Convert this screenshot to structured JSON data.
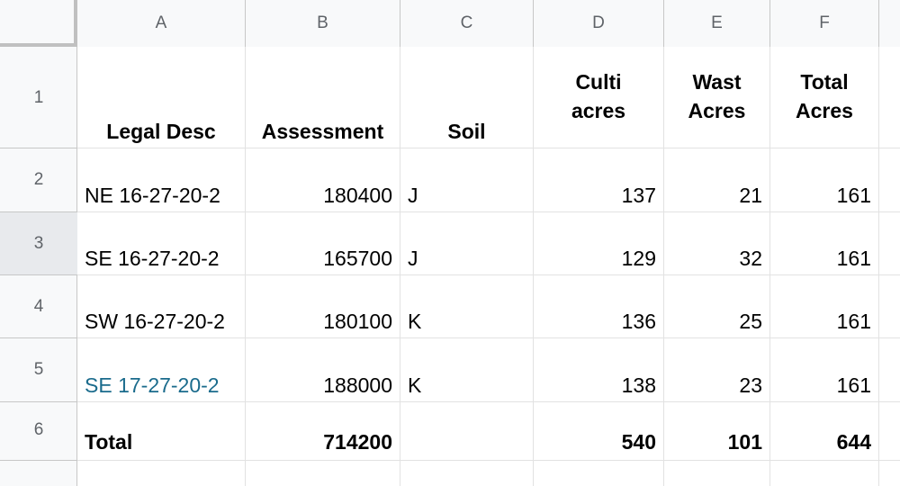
{
  "columns": [
    "A",
    "B",
    "C",
    "D",
    "E",
    "F"
  ],
  "rows": [
    "1",
    "2",
    "3",
    "4",
    "5",
    "6"
  ],
  "header": {
    "legal_desc": "Legal Desc",
    "assessment": "Assessment",
    "soil": "Soil",
    "culti_line1": "Culti",
    "culti_line2": "acres",
    "wast_line1": "Wast",
    "wast_line2": "Acres",
    "total_line1": "Total",
    "total_line2": "Acres"
  },
  "data_rows": [
    {
      "legal": "NE 16-27-20-2",
      "assessment": "180400",
      "soil": "J",
      "culti": "137",
      "wast": "21",
      "total": "161"
    },
    {
      "legal": "SE 16-27-20-2",
      "assessment": "165700",
      "soil": "J",
      "culti": "129",
      "wast": "32",
      "total": "161"
    },
    {
      "legal": "SW 16-27-20-2",
      "assessment": "180100",
      "soil": "K",
      "culti": "136",
      "wast": "25",
      "total": "161"
    },
    {
      "legal": "SE 17-27-20-2",
      "assessment": "188000",
      "soil": "K",
      "culti": "138",
      "wast": "23",
      "total": "161"
    }
  ],
  "totals": {
    "label": "Total",
    "assessment": "714200",
    "culti": "540",
    "wast": "101",
    "total": "644"
  },
  "colors": {
    "link": "#1a6b8c",
    "selected_row_header": "#e8eaed"
  }
}
